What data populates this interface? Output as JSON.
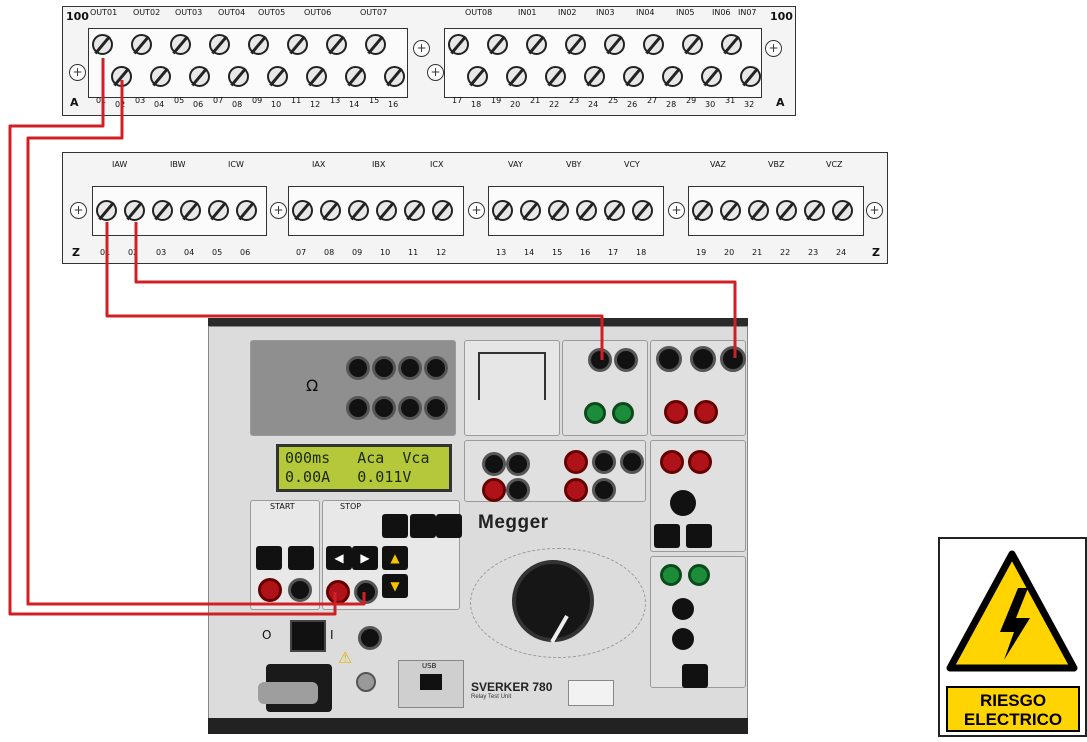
{
  "strip_a": {
    "side_top_left": "100",
    "side_top_right": "100",
    "side_bottom_left": "A",
    "side_bottom_right": "A",
    "outputs": [
      "OUT01",
      "OUT02",
      "OUT03",
      "OUT04",
      "OUT05",
      "OUT06",
      "OUT07",
      "OUT08"
    ],
    "inputs": [
      "IN01",
      "IN02",
      "IN03",
      "IN04",
      "IN05",
      "IN06",
      "IN07"
    ],
    "terminal_numbers": [
      "01",
      "02",
      "03",
      "04",
      "05",
      "06",
      "07",
      "08",
      "09",
      "10",
      "11",
      "12",
      "13",
      "14",
      "15",
      "16",
      "17",
      "18",
      "19",
      "20",
      "21",
      "22",
      "23",
      "24",
      "25",
      "26",
      "27",
      "28",
      "29",
      "30",
      "31",
      "32"
    ]
  },
  "strip_z": {
    "side_left": "Z",
    "side_right": "Z",
    "channels": [
      "IAW",
      "IBW",
      "ICW",
      "IAX",
      "IBX",
      "ICX",
      "VAY",
      "VBY",
      "VCY",
      "VAZ",
      "VBZ",
      "VCZ"
    ],
    "terminal_numbers": [
      "01",
      "02",
      "03",
      "04",
      "05",
      "06",
      "07",
      "08",
      "09",
      "10",
      "11",
      "12",
      "13",
      "14",
      "15",
      "16",
      "17",
      "18",
      "19",
      "20",
      "21",
      "22",
      "23",
      "24"
    ]
  },
  "device": {
    "display_line1": "000ms   Aca  Vca",
    "display_line2": "0.00A   0.011V",
    "brand": "Megger",
    "model": "SVERKER 780",
    "model_sub": "Relay Test Unit",
    "start_label": "START",
    "stop_label": "STOP",
    "ohm_symbol": "Ω",
    "switch_off": "O",
    "switch_on": "I",
    "usb_label": "USB"
  },
  "warning_sign": {
    "line1": "RIESGO",
    "line2": "ELECTRICO"
  },
  "colors": {
    "wire": "#d21f26",
    "lcd": "#b4c83a",
    "sign_yellow": "#ffd400"
  }
}
